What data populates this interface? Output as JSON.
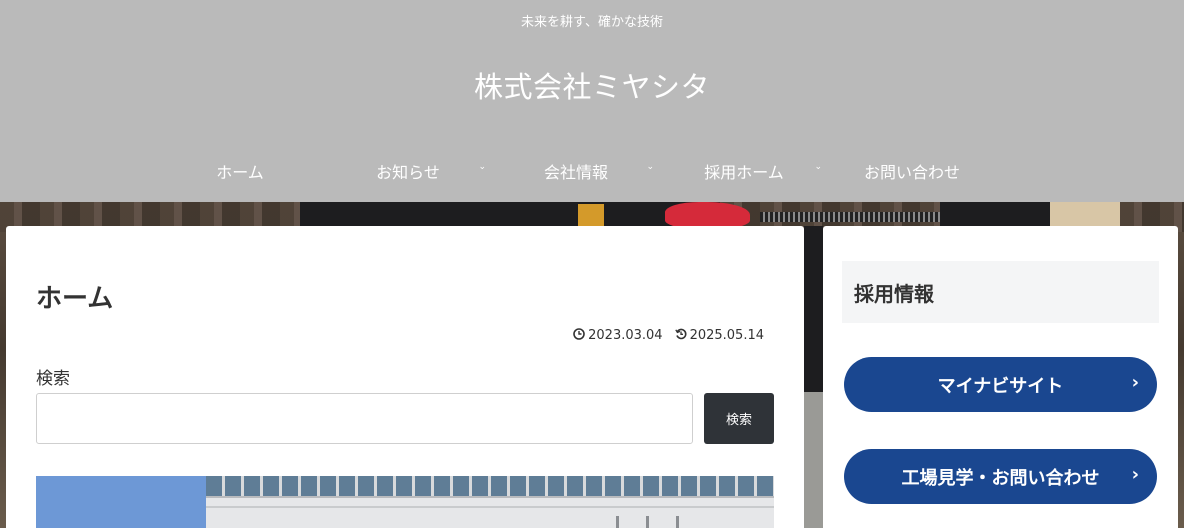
{
  "header": {
    "tagline": "未来を耕す、確かな技術",
    "site_title": "株式会社ミヤシタ"
  },
  "nav": [
    {
      "label": "ホーム",
      "has_dropdown": false
    },
    {
      "label": "お知らせ",
      "has_dropdown": true
    },
    {
      "label": "会社情報",
      "has_dropdown": true
    },
    {
      "label": "採用ホーム",
      "has_dropdown": true
    },
    {
      "label": "お問い合わせ",
      "has_dropdown": false
    }
  ],
  "icons": {
    "dropdown": "chevron-down-icon",
    "published": "clock-icon",
    "updated": "history-icon",
    "pill_arrow": "chevron-right-icon"
  },
  "main": {
    "title": "ホーム",
    "published_date": "2023.03.04",
    "updated_date": "2025.05.14",
    "search_label": "検索",
    "search_value": "",
    "search_button": "検索"
  },
  "sidebar": {
    "heading": "採用情報",
    "links": [
      {
        "label": "マイナビサイト"
      },
      {
        "label": "工場見学・お問い合わせ"
      }
    ]
  },
  "colors": {
    "header_bg": "#bababa",
    "pill_bg": "#1a4790",
    "search_button_bg": "#2f3338",
    "text": "#333333"
  }
}
